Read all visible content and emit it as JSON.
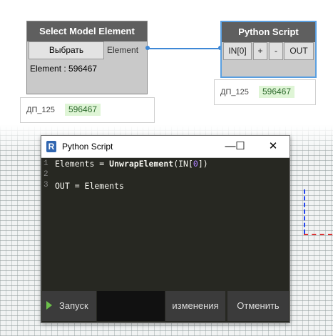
{
  "select_node": {
    "title": "Select Model Element",
    "pick_button": "Выбрать",
    "output_port": "Element",
    "output_value": "Element : 596467"
  },
  "select_watch": {
    "label": "ДП_125",
    "value": "596467"
  },
  "python_node": {
    "title": "Python Script",
    "input_port": "IN[0]",
    "add_port": "+",
    "remove_port": "-",
    "output_port": "OUT"
  },
  "python_watch": {
    "label": "ДП_125",
    "value": "596467"
  },
  "editor": {
    "window_title": "Python Script",
    "window_icon": "revit-r-icon",
    "minimize": "—",
    "maximize": "☐",
    "close": "✕",
    "line_numbers": [
      "1",
      "2",
      "3"
    ],
    "code": {
      "line1_var": "Elements = ",
      "line1_fn": "UnwrapElement",
      "line1_open": "(IN[",
      "line1_num": "0",
      "line1_close": "])",
      "line3": "OUT = Elements"
    },
    "buttons": {
      "run": "Запуск",
      "save_changes": "изменения",
      "cancel": "Отменить"
    }
  },
  "colors": {
    "node_header": "#5f5f5f",
    "node_body": "#c9c9c9",
    "connector": "#3e88d6",
    "editor_bg": "#272822",
    "watch_value_bg": "#dff5d6"
  }
}
